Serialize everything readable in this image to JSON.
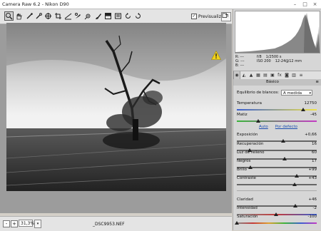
{
  "window": {
    "title": "Camera Raw 6.2  -  Nikon D90",
    "minimize": "–",
    "maximize": "□",
    "close": "×"
  },
  "toolbar": {
    "tools": [
      "zoom-tool",
      "hand-tool",
      "white-balance-tool",
      "color-sampler-tool",
      "targeted-adjustment-tool",
      "crop-tool",
      "straighten-tool",
      "spot-removal-tool",
      "red-eye-tool",
      "adjustment-brush-tool",
      "graduated-filter-tool",
      "preferences-tool",
      "rotate-ccw-tool",
      "rotate-cw-tool"
    ],
    "preview_label": "Previsualizar",
    "preview_checked": "✓"
  },
  "status": {
    "zoom_minus": "-",
    "zoom_plus": "+",
    "zoom": "31,3%",
    "zoom_dd": "▾",
    "filename": "_DSC9953.NEF"
  },
  "info": {
    "r": "R:   ---",
    "g": "G:   ---",
    "b": "B:   ---",
    "aperture": "f/8",
    "shutter": "1/2500 s",
    "iso": "ISO 200",
    "lens": "12-24@12 mm"
  },
  "panel": {
    "tab_icons": [
      "◉",
      "◭",
      "▲",
      "▦",
      "▤",
      "▣",
      "fx",
      "◙",
      "▥",
      "≡"
    ],
    "section_title": "Básico",
    "section_menu": "≡",
    "wb_label": "Equilibrio de blancos:",
    "wb_value": "A medida",
    "auto_link": "Auto",
    "default_link": "Por defecto"
  },
  "sliders": [
    {
      "key": "temperatura",
      "label": "Temperatura",
      "value": "12750",
      "pos": 0.83,
      "gradient": "linear-gradient(90deg,#3a5fd0,#f0e34a)"
    },
    {
      "key": "matiz",
      "label": "Matiz",
      "value": "-45",
      "pos": 0.27,
      "gradient": "linear-gradient(90deg,#3ab43a,#c43ac4)"
    },
    {
      "key": "exposicion",
      "label": "Exposición",
      "value": "+0,66",
      "pos": 0.58,
      "gradient": "linear-gradient(90deg,#666,#666)"
    },
    {
      "key": "recuperacion",
      "label": "Recuperación",
      "value": "16",
      "pos": 0.16,
      "gradient": "linear-gradient(90deg,#666,#666)"
    },
    {
      "key": "luz-relleno",
      "label": "Luz de relleno",
      "value": "60",
      "pos": 0.6,
      "gradient": "linear-gradient(90deg,#666,#666)"
    },
    {
      "key": "negros",
      "label": "Negros",
      "value": "17",
      "pos": 0.17,
      "gradient": "linear-gradient(90deg,#666,#666)"
    },
    {
      "key": "brillo",
      "label": "Brillo",
      "value": "+99",
      "pos": 0.75,
      "gradient": "linear-gradient(90deg,#666,#666)"
    },
    {
      "key": "contraste",
      "label": "Contraste",
      "value": "+43",
      "pos": 0.72,
      "gradient": "linear-gradient(90deg,#666,#666)"
    },
    {
      "key": "claridad",
      "label": "Claridad",
      "value": "+46",
      "pos": 0.73,
      "gradient": "linear-gradient(90deg,#666,#666)"
    },
    {
      "key": "intensidad",
      "label": "Intensidad",
      "value": "-2",
      "pos": 0.49,
      "gradient": "linear-gradient(90deg,#888,#c43a3a,#3a5fd0)"
    },
    {
      "key": "saturacion",
      "label": "Saturación",
      "value": "-100",
      "pos": 0.0,
      "gradient": "linear-gradient(90deg,#888,#c43a3a,#e0a030,#3ab43a,#3a5fd0,#c43ac4)"
    }
  ]
}
